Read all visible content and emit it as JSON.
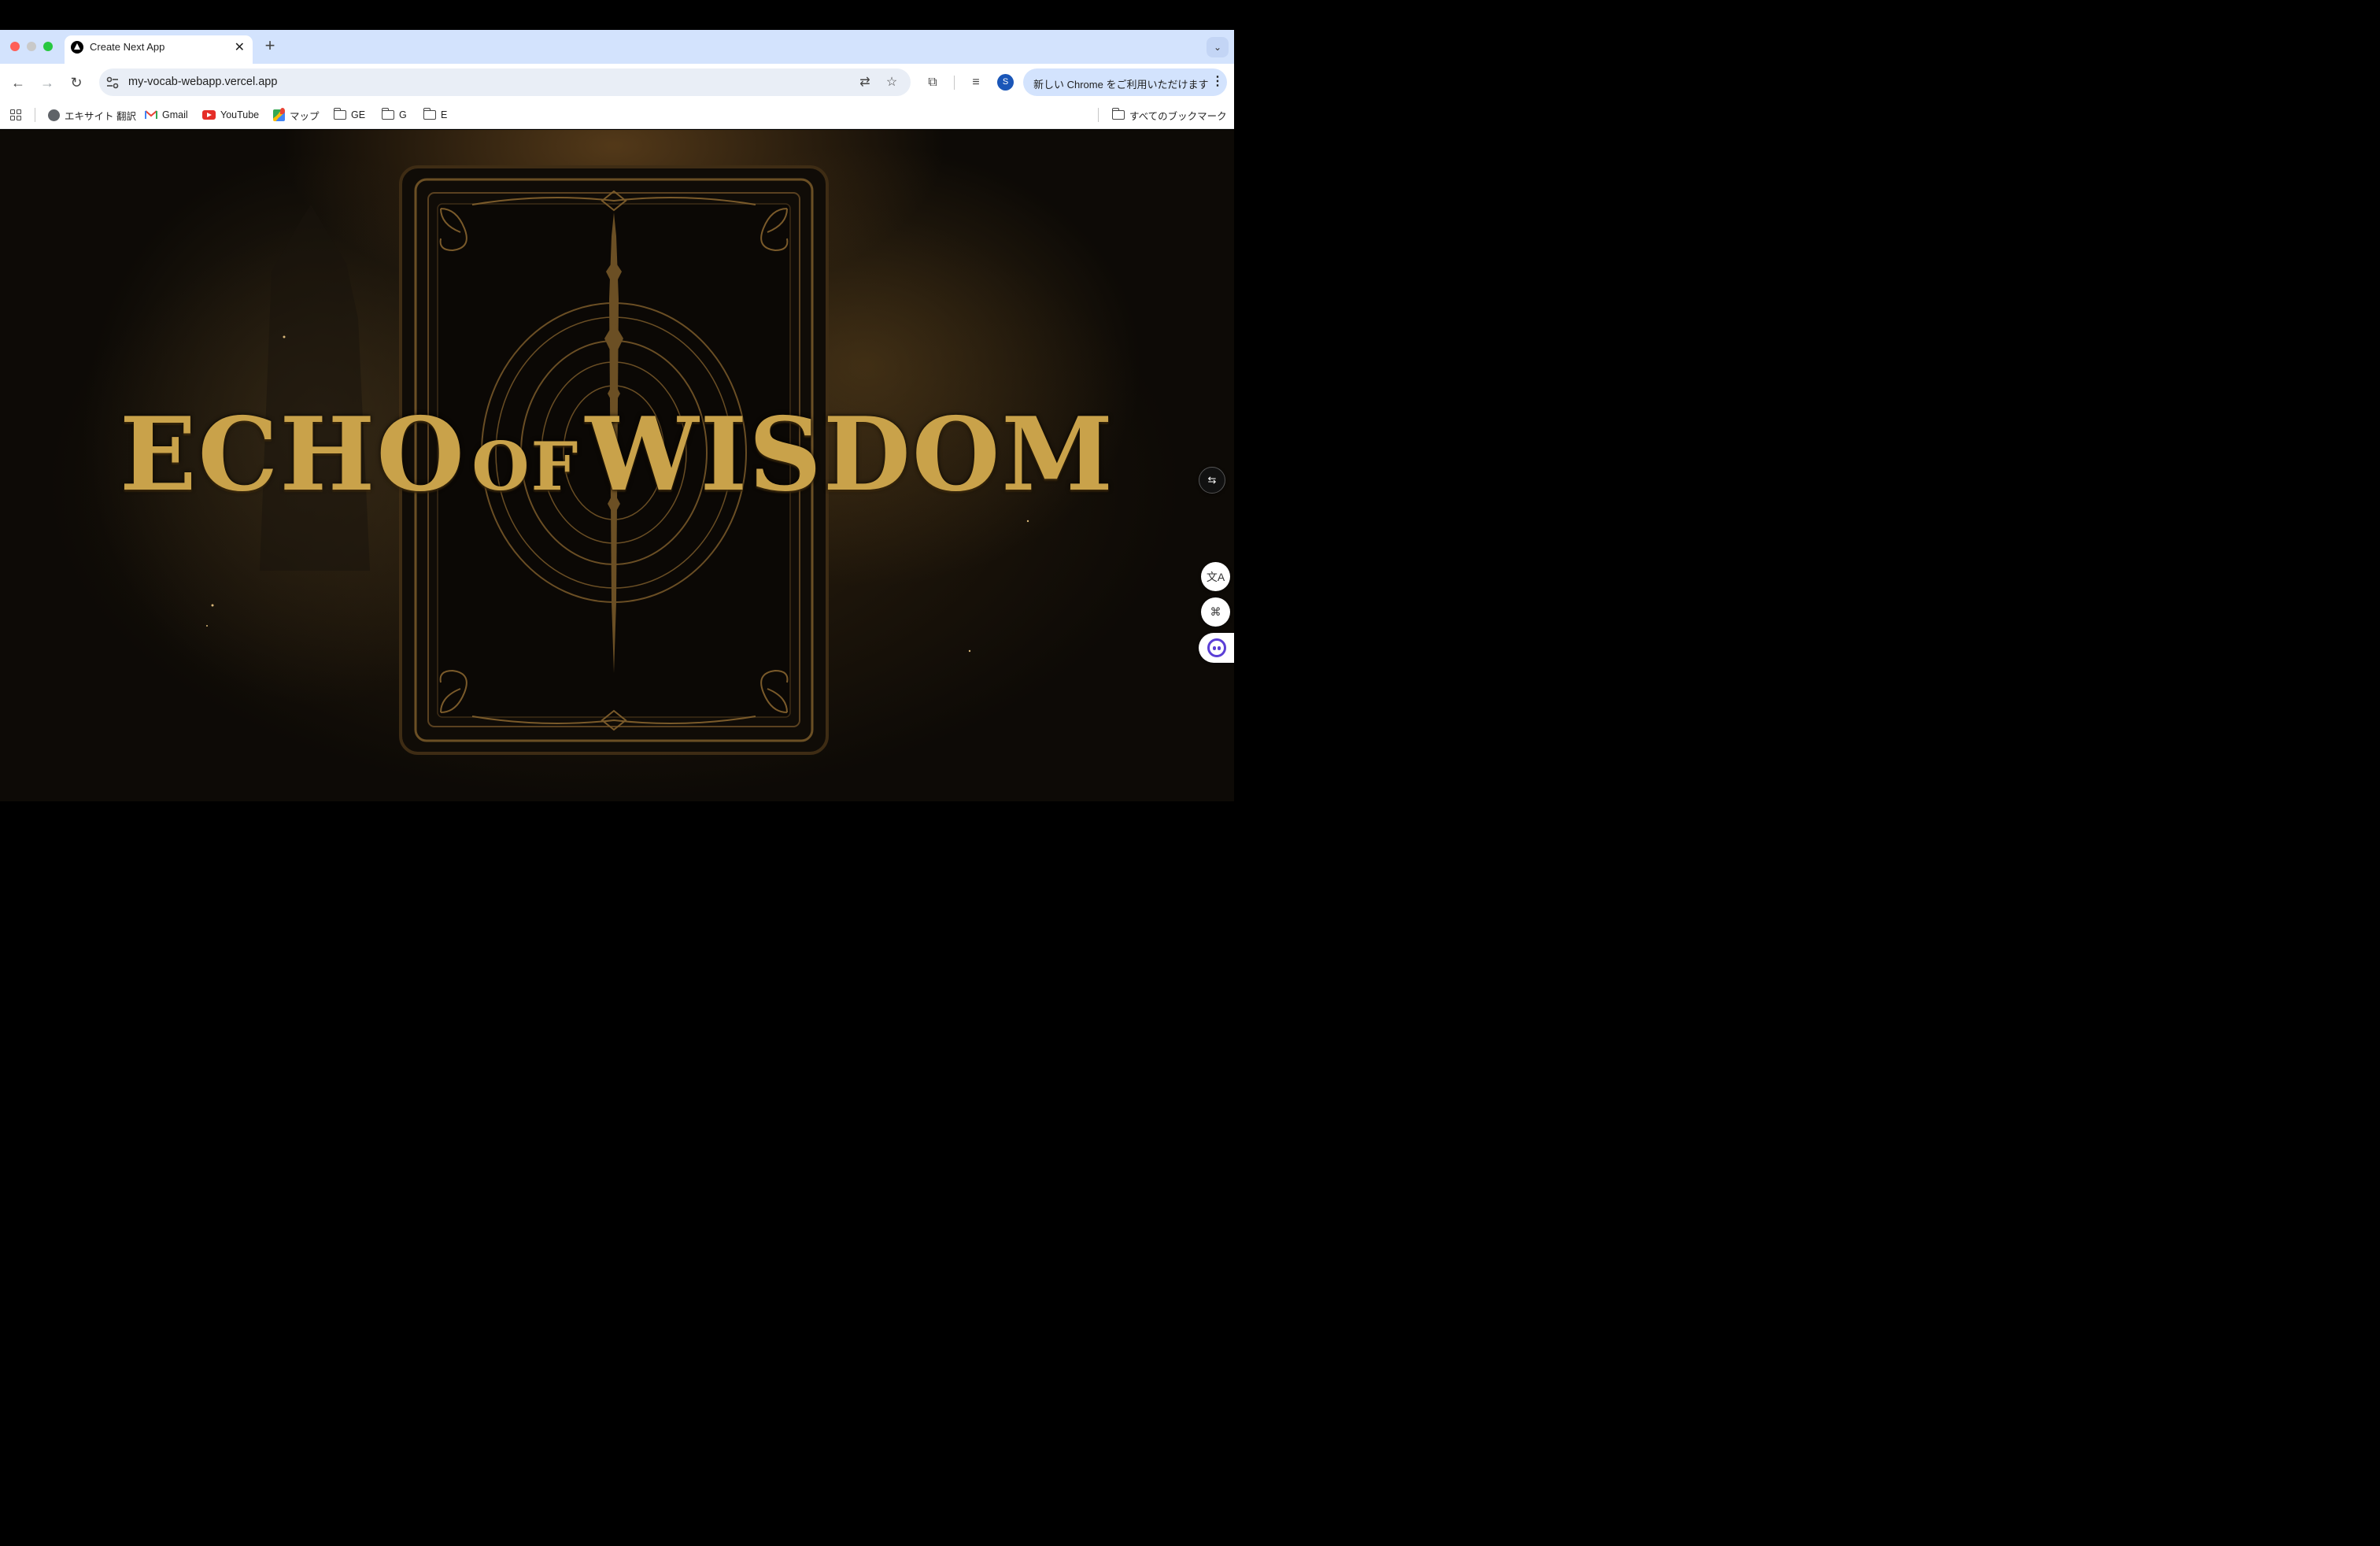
{
  "browser": {
    "tab": {
      "title": "Create Next App",
      "close": "✕"
    },
    "new_tab": "+",
    "tab_search": "⌄",
    "url": "my-vocab-webapp.vercel.app",
    "avatar_initial": "S",
    "promo_text": "新しい Chrome をご利用いただけます",
    "promo_more": "⋮",
    "nav": {
      "back": "←",
      "forward": "→",
      "reload": "↻"
    },
    "omnibox_icons": {
      "translate": "⇄",
      "bookmark_star": "☆"
    },
    "toolbar_icons": {
      "extensions": "⧉",
      "media": "≡"
    }
  },
  "bookmarks": {
    "items": [
      {
        "label": "エキサイト 翻訳",
        "icon": "globe-icon"
      },
      {
        "label": "Gmail",
        "icon": "gmail-icon"
      },
      {
        "label": "YouTube",
        "icon": "youtube-icon"
      },
      {
        "label": "マップ",
        "icon": "maps-icon"
      },
      {
        "label": "GE",
        "icon": "folder-icon"
      },
      {
        "label": "G",
        "icon": "folder-icon"
      },
      {
        "label": "E",
        "icon": "folder-icon"
      }
    ],
    "all_bookmarks": "すべてのブックマーク"
  },
  "page": {
    "title_part1": "ECHO",
    "title_part2": "OF",
    "title_part3": "WISDOM"
  },
  "floating": {
    "side_panel": "⇆",
    "translate": "文A",
    "apps": "⌘"
  },
  "colors": {
    "tabstrip": "#d3e3fd",
    "title_gold": "#c9a24a",
    "card_border": "#6b4f24"
  }
}
